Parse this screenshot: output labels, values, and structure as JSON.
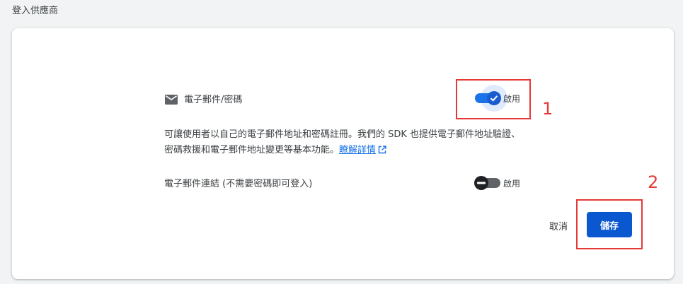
{
  "section": {
    "title": "登入供應商"
  },
  "provider": {
    "icon": "mail-icon",
    "name": "電子郵件/密碼",
    "enabled": true,
    "toggle_label": "啟用",
    "description": "可讓使用者以自己的電子郵件地址和密碼註冊。我們的 SDK 也提供電子郵件地址驗證、密碼救援和電子郵件地址變更等基本功能。",
    "learn_more_label": "瞭解詳情"
  },
  "email_link": {
    "label": "電子郵件連結 (不需要密碼即可登入)",
    "enabled": false,
    "toggle_label": "啟用"
  },
  "actions": {
    "cancel_label": "取消",
    "save_label": "儲存"
  },
  "annotations": {
    "callout_1": "1",
    "callout_2": "2",
    "color": "#e53935"
  },
  "colors": {
    "accent": "#1a73e8",
    "save_button": "#0b57d0",
    "background": "#f1f3f4"
  }
}
